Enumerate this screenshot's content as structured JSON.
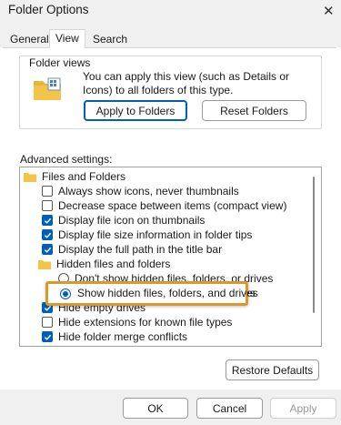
{
  "window": {
    "title": "Folder Options",
    "close_glyph": "✕"
  },
  "tabs": [
    {
      "label": "General",
      "active": false
    },
    {
      "label": "View",
      "active": true
    },
    {
      "label": "Search",
      "active": false
    }
  ],
  "folder_views": {
    "label": "Folder views",
    "description": "You can apply this view (such as Details or Icons) to all folders of this type.",
    "icon": "folder-grid-icon",
    "apply_button": "Apply to Folders",
    "reset_button": "Reset Folders"
  },
  "advanced": {
    "label": "Advanced settings:",
    "items": [
      {
        "type": "folder",
        "label": "Files and Folders",
        "indent": 0
      },
      {
        "type": "checkbox",
        "label": "Always show icons, never thumbnails",
        "checked": false
      },
      {
        "type": "checkbox",
        "label": "Decrease space between items (compact view)",
        "checked": false
      },
      {
        "type": "checkbox",
        "label": "Display file icon on thumbnails",
        "checked": true
      },
      {
        "type": "checkbox",
        "label": "Display file size information in folder tips",
        "checked": true
      },
      {
        "type": "checkbox",
        "label": "Display the full path in the title bar",
        "checked": true
      },
      {
        "type": "folder",
        "label": "Hidden files and folders",
        "indent": 1
      },
      {
        "type": "radio",
        "label": "Don't show hidden files, folders, or drives",
        "checked": false
      },
      {
        "type": "radio",
        "label": "Show hidden files, folders, and drives",
        "checked": true
      },
      {
        "type": "checkbox",
        "label": "Hide empty drives",
        "checked": true
      },
      {
        "type": "checkbox",
        "label": "Hide extensions for known file types",
        "checked": false
      },
      {
        "type": "checkbox",
        "label": "Hide folder merge conflicts",
        "checked": true
      }
    ],
    "highlighted_option": "Show hidden files, folders, and drives"
  },
  "buttons": {
    "restore_defaults": "Restore Defaults",
    "ok": "OK",
    "cancel": "Cancel",
    "apply": "Apply"
  },
  "colors": {
    "accent": "#005fb8",
    "highlight_border": "#d79b2b",
    "folder": "#f2c447"
  }
}
